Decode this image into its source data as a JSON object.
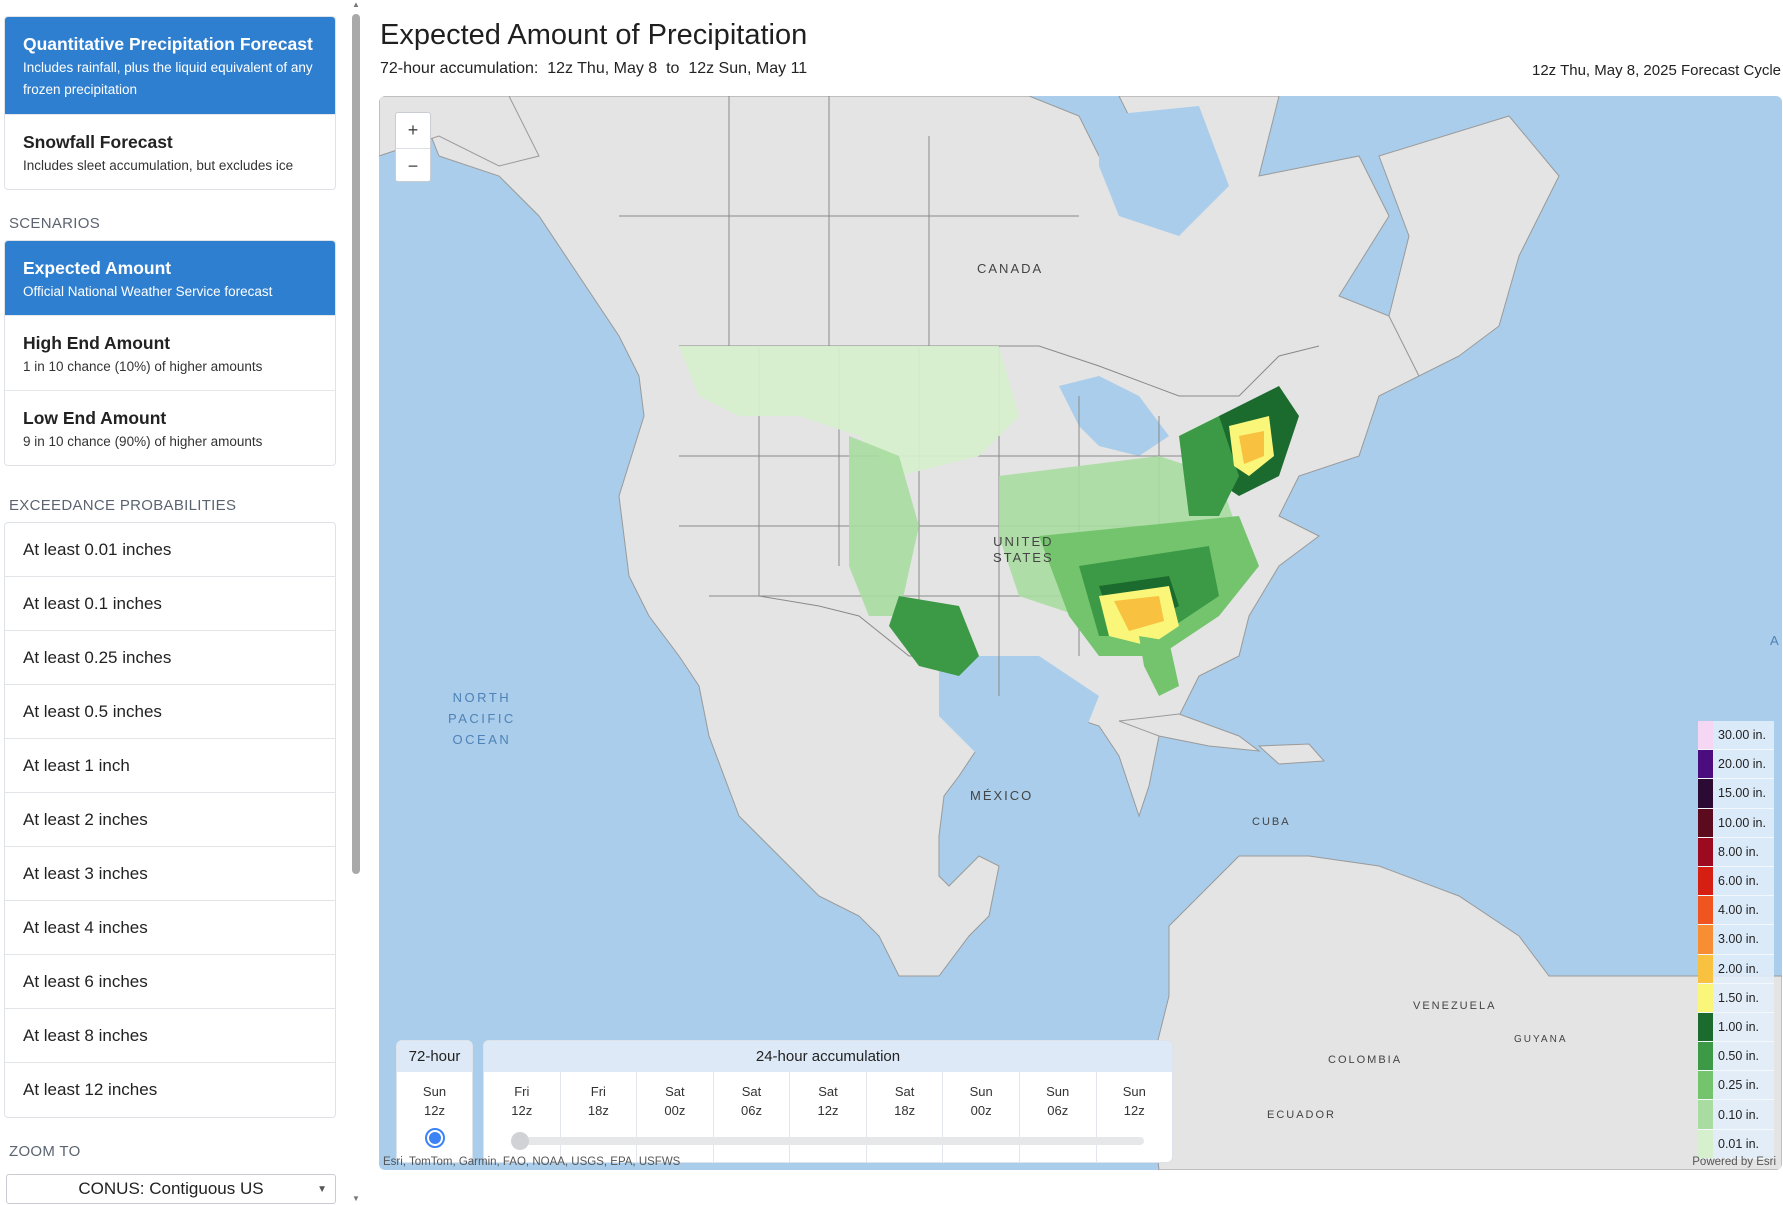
{
  "sidebar": {
    "products": [
      {
        "title": "Quantitative Precipitation Forecast",
        "subtitle": "Includes rainfall, plus the liquid equivalent of any frozen precipitation",
        "active": true
      },
      {
        "title": "Snowfall Forecast",
        "subtitle": "Includes sleet accumulation, but excludes ice",
        "active": false
      }
    ],
    "scenarios_heading": "SCENARIOS",
    "scenarios": [
      {
        "title": "Expected Amount",
        "subtitle": "Official National Weather Service forecast",
        "active": true
      },
      {
        "title": "High End Amount",
        "subtitle": "1 in 10 chance (10%) of higher amounts",
        "active": false
      },
      {
        "title": "Low End Amount",
        "subtitle": "9 in 10 chance (90%) of higher amounts",
        "active": false
      }
    ],
    "exceedance_heading": "EXCEEDANCE PROBABILITIES",
    "exceedance": [
      "At least 0.01 inches",
      "At least 0.1 inches",
      "At least 0.25 inches",
      "At least 0.5 inches",
      "At least 1 inch",
      "At least 2 inches",
      "At least 3 inches",
      "At least 4 inches",
      "At least 6 inches",
      "At least 8 inches",
      "At least 12 inches"
    ],
    "zoom_heading": "ZOOM TO",
    "zoom_value": "CONUS: Contiguous US"
  },
  "header": {
    "title": "Expected Amount of Precipitation",
    "subtitle": "72-hour accumulation:  12z Thu, May 8  to  12z Sun, May 11",
    "cycle": "12z Thu, May 8, 2025 Forecast Cycle"
  },
  "map": {
    "zoom_in": "+",
    "zoom_out": "−",
    "labels": {
      "canada": "CANADA",
      "united_states": "UNITED\nSTATES",
      "mexico": "MÉXICO",
      "cuba": "CUBA",
      "venezuela": "VENEZUELA",
      "guyana": "GUYANA",
      "colombia": "COLOMBIA",
      "ecuador": "ECUADOR",
      "north_pacific": "NORTH\nPACIFIC\nOCEAN",
      "atlantic_cut": "A"
    },
    "attribution": "Esri, TomTom, Garmin, FAO, NOAA, USGS, EPA, USFWS",
    "powered_by": "Powered by Esri"
  },
  "legend": [
    {
      "label": "30.00 in.",
      "color": "#f5d6f3"
    },
    {
      "label": "20.00 in.",
      "color": "#4b0c7e"
    },
    {
      "label": "15.00 in.",
      "color": "#2b0a33"
    },
    {
      "label": "10.00 in.",
      "color": "#5c0a1e"
    },
    {
      "label": "8.00 in.",
      "color": "#9b0a1f"
    },
    {
      "label": "6.00 in.",
      "color": "#d51f13"
    },
    {
      "label": "4.00 in.",
      "color": "#f0551f"
    },
    {
      "label": "3.00 in.",
      "color": "#f88e34"
    },
    {
      "label": "2.00 in.",
      "color": "#f8c13f"
    },
    {
      "label": "1.50 in.",
      "color": "#f9f67a"
    },
    {
      "label": "1.00 in.",
      "color": "#1b6a2e"
    },
    {
      "label": "0.50 in.",
      "color": "#3c9a46"
    },
    {
      "label": "0.25 in.",
      "color": "#74c46e"
    },
    {
      "label": "0.10 in.",
      "color": "#a8dca0"
    },
    {
      "label": "0.01 in.",
      "color": "#d6efcc"
    }
  ],
  "time_panel": {
    "total_header": "72-hour",
    "total_day": "Sun",
    "total_time": "12z",
    "daily_header": "24-hour accumulation",
    "steps": [
      {
        "day": "Fri",
        "time": "12z"
      },
      {
        "day": "Fri",
        "time": "18z"
      },
      {
        "day": "Sat",
        "time": "00z"
      },
      {
        "day": "Sat",
        "time": "06z"
      },
      {
        "day": "Sat",
        "time": "12z"
      },
      {
        "day": "Sat",
        "time": "18z"
      },
      {
        "day": "Sun",
        "time": "00z"
      },
      {
        "day": "Sun",
        "time": "06z"
      },
      {
        "day": "Sun",
        "time": "12z"
      }
    ]
  }
}
